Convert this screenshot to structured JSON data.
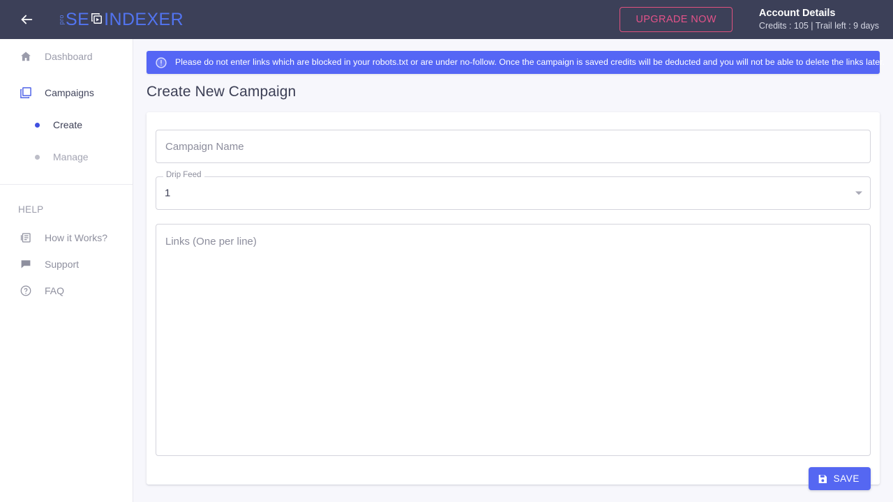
{
  "header": {
    "back_icon": "arrow-left-icon",
    "logo": {
      "pro": "pro",
      "part1": "SE",
      "icon": "launch-window-icon",
      "part2": "INDEXER"
    },
    "upgrade_label": "UPGRADE NOW",
    "account_title": "Account Details",
    "account_sub": "Credits : 105 | Trail left : 9 days",
    "colors": {
      "bar_bg": "#3c4058",
      "logo": "#5274f0",
      "upgrade": "#e35289"
    }
  },
  "sidebar": {
    "items": [
      {
        "label": "Dashboard",
        "icon": "home-icon"
      },
      {
        "label": "Campaigns",
        "icon": "layers-icon"
      }
    ],
    "sub_items": [
      {
        "label": "Create",
        "active": true
      },
      {
        "label": "Manage",
        "active": false
      }
    ],
    "help_heading": "HELP",
    "help_items": [
      {
        "label": "How it Works?",
        "icon": "article-icon"
      },
      {
        "label": "Support",
        "icon": "chat-icon"
      },
      {
        "label": "FAQ",
        "icon": "help-circle-icon"
      }
    ]
  },
  "main": {
    "banner": {
      "icon": "error-outline-icon",
      "text": "Please do not enter links which are blocked in your robots.txt or are under no-follow. Once the campaign is saved credits will be deducted and you will not be able to delete the links later.",
      "color": "#5566f5"
    },
    "page_title": "Create New Campaign",
    "form": {
      "campaign_name": {
        "placeholder": "Campaign Name",
        "value": ""
      },
      "drip_feed": {
        "label": "Drip Feed",
        "value": "1",
        "caret_icon": "chevron-down-icon"
      },
      "links": {
        "placeholder": "Links (One per line)",
        "value": ""
      },
      "save_label": "SAVE",
      "save_icon": "save-icon",
      "save_color": "#5567f2"
    }
  }
}
